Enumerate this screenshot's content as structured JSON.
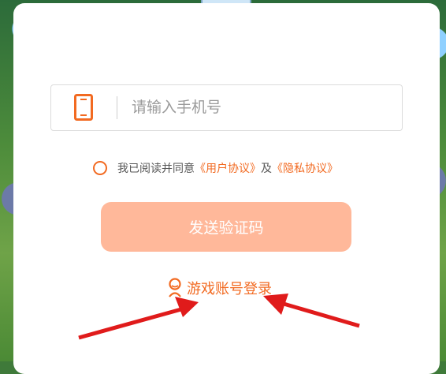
{
  "login": {
    "phone_placeholder": "请输入手机号",
    "agree_prefix": "我已阅读并同意",
    "user_agreement": "《用户协议》",
    "and_text": "及",
    "privacy_agreement": "《隐私协议》",
    "send_code_label": "发送验证码",
    "game_account_login_label": "游戏账号登录"
  },
  "colors": {
    "accent": "#f26a21",
    "button_disabled": "#ffb89a",
    "annotation_arrow": "#e01b1b"
  },
  "icons": {
    "phone": "phone-icon",
    "radio": "radio-circle",
    "game_login": "person-icon"
  }
}
